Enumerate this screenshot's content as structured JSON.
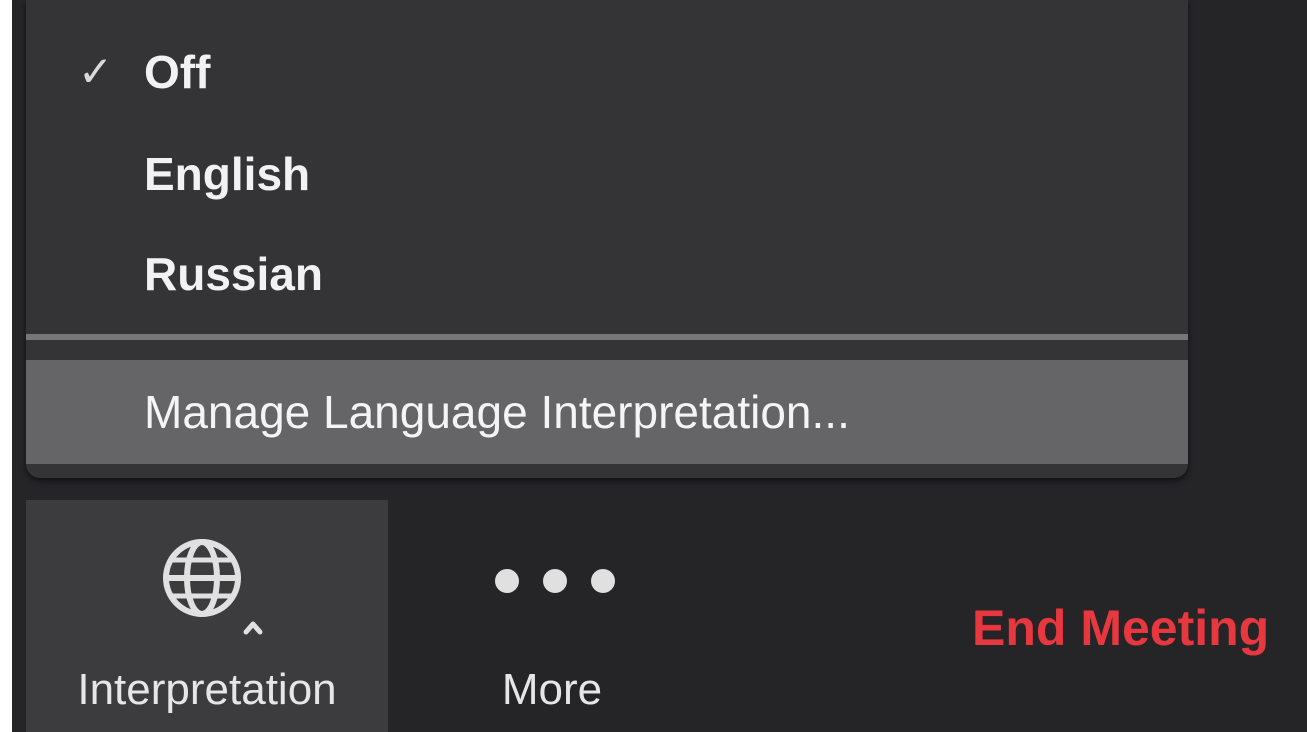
{
  "menu": {
    "items": [
      {
        "label": "Off",
        "checked": true
      },
      {
        "label": "English",
        "checked": false
      },
      {
        "label": "Russian",
        "checked": false
      }
    ],
    "check_mark": "✓",
    "manage_label": "Manage Language Interpretation..."
  },
  "toolbar": {
    "interpretation_label": "Interpretation",
    "interpretation_icon": "globe-icon",
    "more_label": "More",
    "more_icon": "more-dots-icon",
    "end_meeting_label": "End Meeting"
  },
  "colors": {
    "end_meeting": "#e8383f",
    "menu_background": "#343437",
    "highlight": "#656568",
    "toolbar_background": "#252528"
  }
}
